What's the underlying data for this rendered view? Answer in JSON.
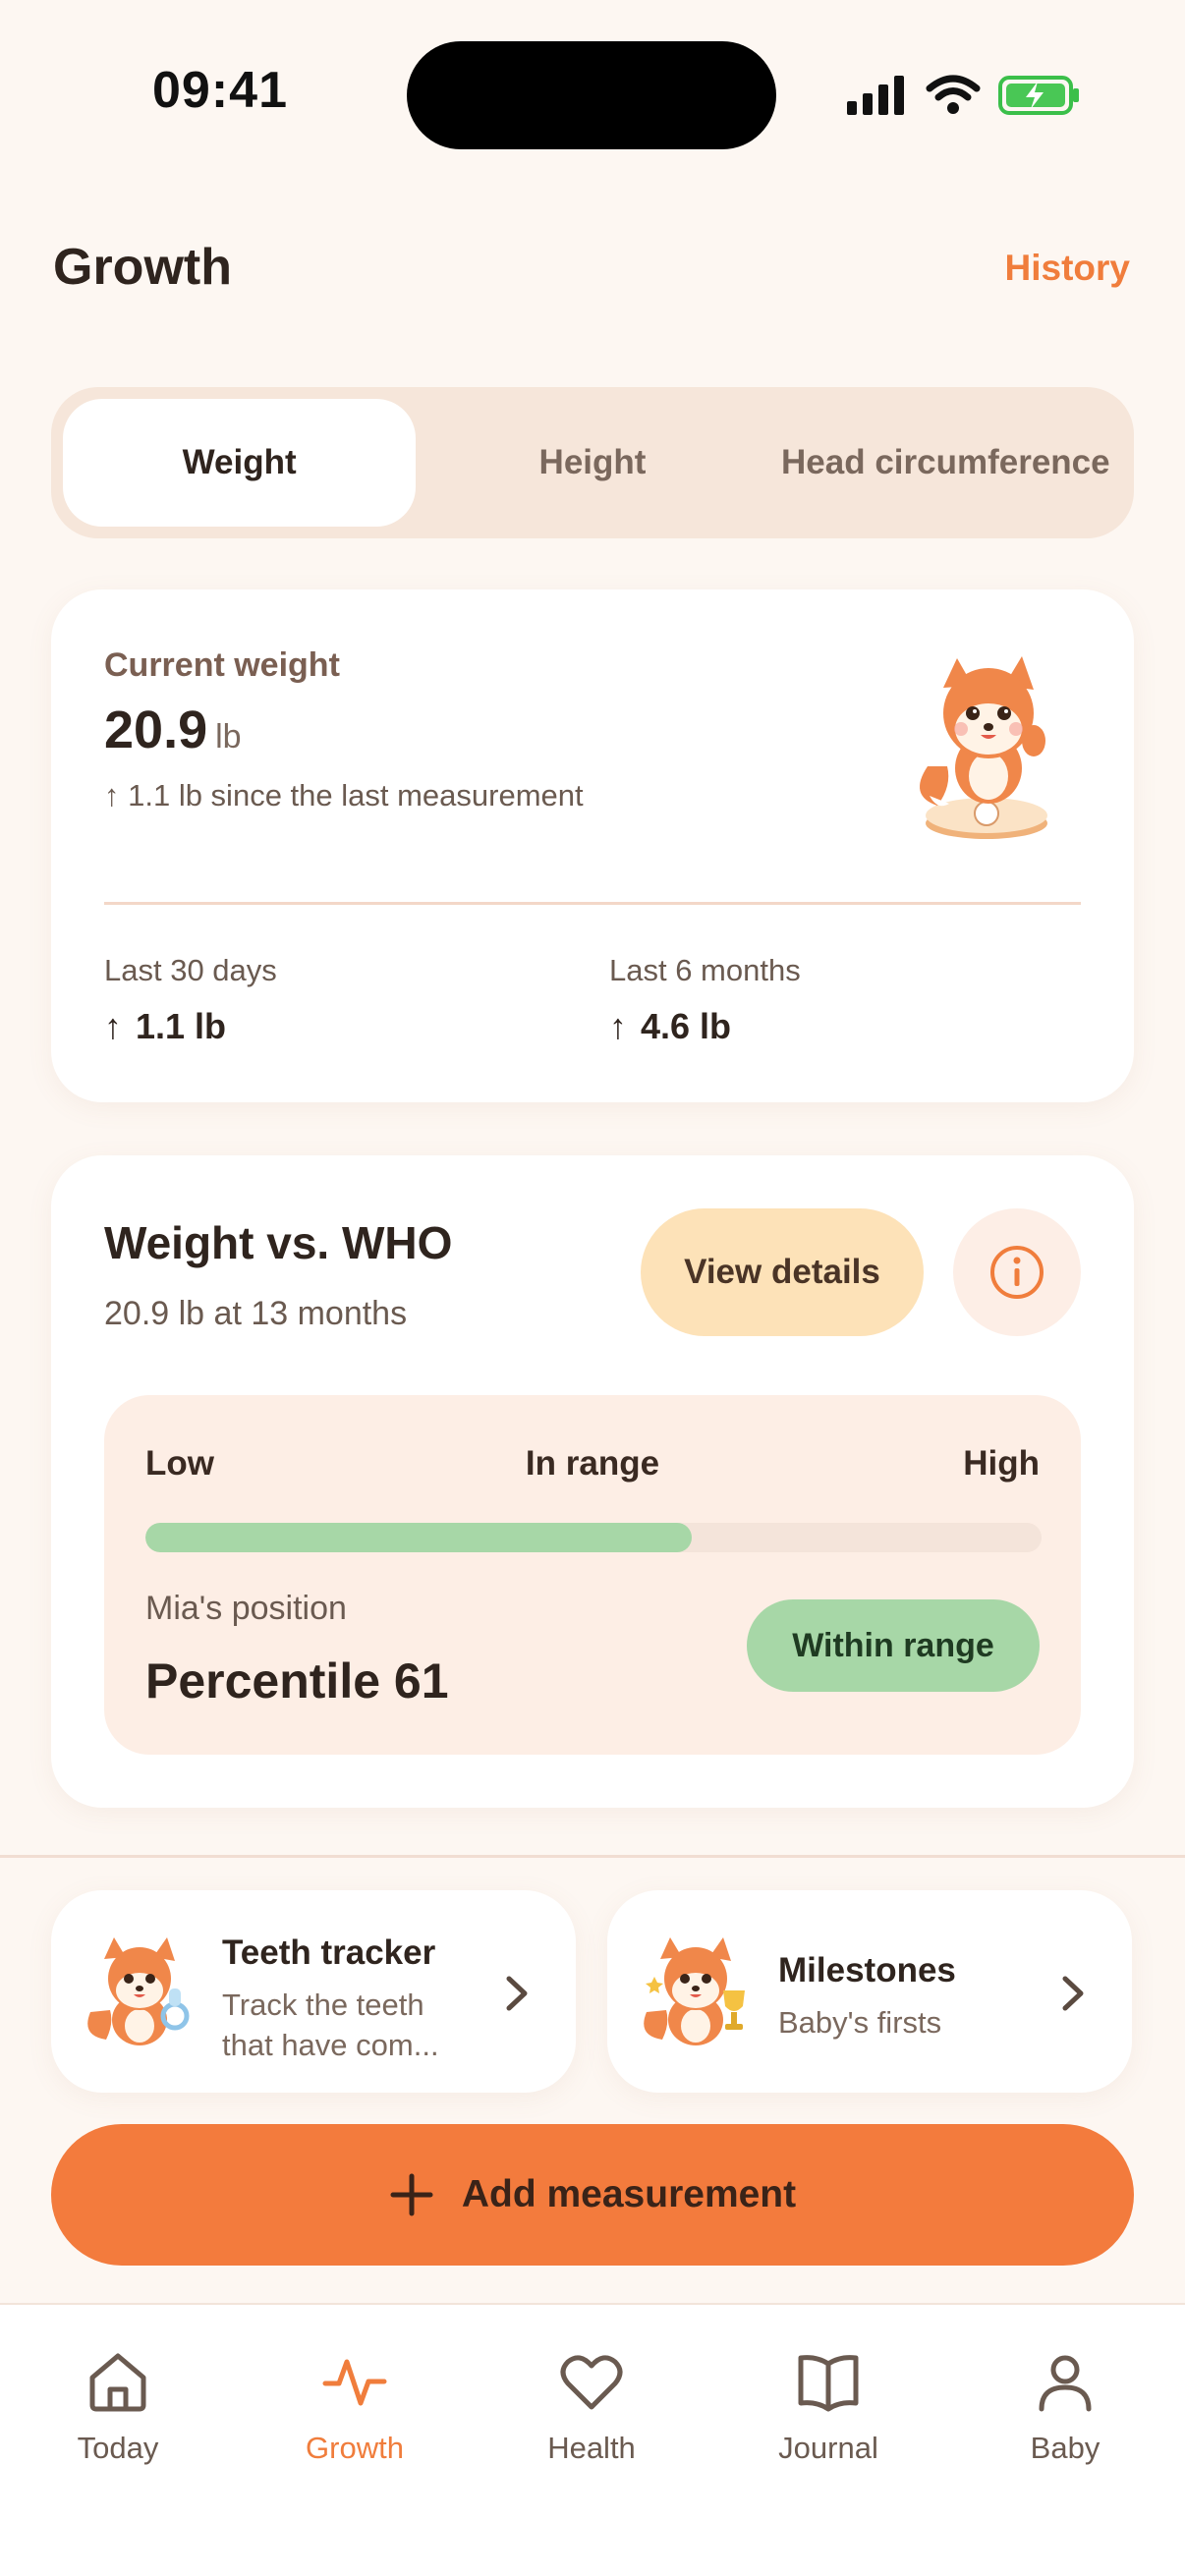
{
  "status_bar": {
    "time": "09:41"
  },
  "header": {
    "title": "Growth",
    "history_link": "History"
  },
  "segments": [
    {
      "label": "Weight",
      "active": true
    },
    {
      "label": "Height",
      "active": false
    },
    {
      "label": "Head circumference",
      "active": false
    }
  ],
  "current_weight": {
    "label": "Current weight",
    "value": "20.9",
    "unit": "lb",
    "delta": "↑ 1.1 lb since the last measurement",
    "stats": [
      {
        "label": "Last 30 days",
        "value": "1.1 lb"
      },
      {
        "label": "Last 6 months",
        "value": "4.6 lb"
      }
    ]
  },
  "who": {
    "title": "Weight vs. WHO",
    "subtitle": "20.9 lb at 13 months",
    "view_details": "View details",
    "range_labels": {
      "low": "Low",
      "mid": "In range",
      "high": "High"
    },
    "position_label": "Mia's position",
    "position_value": "Percentile 61",
    "percentile": 61,
    "status": "Within range"
  },
  "shortcuts": [
    {
      "title": "Teeth tracker",
      "subtitle": "Track the teeth that have com..."
    },
    {
      "title": "Milestones",
      "subtitle": "Baby's firsts"
    }
  ],
  "add_button": {
    "label": "Add measurement"
  },
  "tabbar": [
    {
      "label": "Today",
      "icon": "home-icon",
      "active": false
    },
    {
      "label": "Growth",
      "icon": "pulse-icon",
      "active": true
    },
    {
      "label": "Health",
      "icon": "heart-icon",
      "active": false
    },
    {
      "label": "Journal",
      "icon": "book-icon",
      "active": false
    },
    {
      "label": "Baby",
      "icon": "person-icon",
      "active": false
    }
  ],
  "colors": {
    "accent": "#f37b3d",
    "range_green": "#a7d7a7",
    "background": "#fdf7f2"
  }
}
